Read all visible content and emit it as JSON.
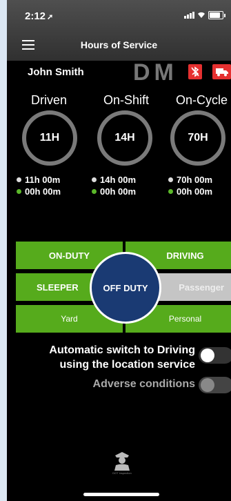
{
  "status_bar": {
    "time": "2:12",
    "location_arrow": "➚",
    "icons": [
      "signal-icon",
      "wifi-icon",
      "battery-icon"
    ]
  },
  "header": {
    "title": "Hours of Service",
    "menu_icon": "hamburger-menu-icon"
  },
  "driver": {
    "name": "John Smith",
    "mode_letters": "DM",
    "badges": [
      "bluetooth-disabled-icon",
      "truck-icon"
    ]
  },
  "clocks": [
    {
      "label": "Driven",
      "dial": "11H",
      "remaining": "11h 00m",
      "used": "00h 00m"
    },
    {
      "label": "On-Shift",
      "dial": "14H",
      "remaining": "14h 00m",
      "used": "00h 00m"
    },
    {
      "label": "On-Cycle",
      "dial": "70H",
      "remaining": "70h 00m",
      "used": "00h 00m"
    }
  ],
  "status_grid": {
    "on_duty": "ON-DUTY",
    "driving": "DRIVING",
    "sleeper": "SLEEPER",
    "passenger": "Passenger",
    "yard": "Yard",
    "personal": "Personal",
    "off_duty": "OFF DUTY"
  },
  "settings": {
    "auto_switch_label": "Automatic switch to Driving using the location service",
    "auto_switch_line1": "Automatic switch to Driving",
    "auto_switch_line2": "using the location service",
    "auto_switch_on": false,
    "adverse_label": "Adverse conditions",
    "adverse_on": false
  },
  "footer": {
    "officer_icon": "dot-inspector-icon",
    "officer_caption": "DOT inspection"
  },
  "colors": {
    "green": "#56ab1c",
    "navy": "#1a3a73",
    "red": "#e53030",
    "gray": "#c5c5c5"
  }
}
